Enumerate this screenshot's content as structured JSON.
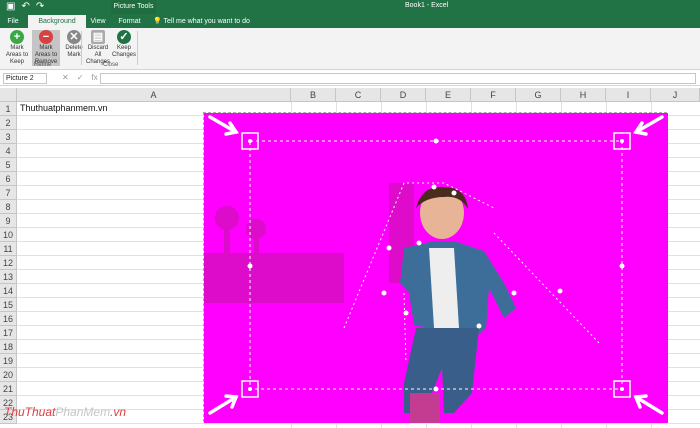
{
  "window": {
    "title": "Book1 - Excel"
  },
  "tabs": {
    "context_group": "Picture Tools",
    "file": "File",
    "background_removal": "Background Removal",
    "view": "View",
    "format": "Format",
    "tell_me": "Tell me what you want to do"
  },
  "ribbon": {
    "mark_keep": "Mark Areas to Keep",
    "mark_remove": "Mark Areas to Remove",
    "delete_mark": "Delete Mark",
    "refine_group": "Refine",
    "discard": "Discard All Changes",
    "keep_changes": "Keep Changes",
    "close_group": "Close"
  },
  "formula_bar": {
    "name_box": "Picture 2",
    "cancel": "✕",
    "enter": "✓",
    "fx": "fx"
  },
  "sheet": {
    "columns": [
      "A",
      "B",
      "C",
      "D",
      "E",
      "F",
      "G",
      "H",
      "I",
      "J"
    ],
    "rows": [
      "1",
      "2",
      "3",
      "4",
      "5",
      "6",
      "7",
      "8",
      "9",
      "10",
      "11",
      "12",
      "13",
      "14",
      "15",
      "16",
      "17",
      "18",
      "19",
      "20",
      "21",
      "22",
      "23"
    ],
    "cell_A1": "Thuthuatphanmem.vn"
  },
  "watermark": {
    "part1": "ThuThuat",
    "part2": "PhanMem",
    "part3": ".vn"
  },
  "colors": {
    "accent": "#217346",
    "magenta": "#ff00ff"
  }
}
